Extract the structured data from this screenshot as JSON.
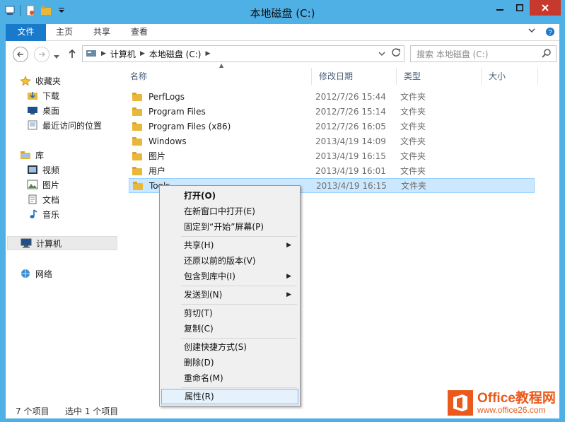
{
  "window": {
    "title": "本地磁盘 (C:)"
  },
  "ribbon": {
    "tabs": [
      "文件",
      "主页",
      "共享",
      "查看"
    ]
  },
  "address": {
    "crumbs": [
      "计算机",
      "本地磁盘 (C:)"
    ],
    "search_placeholder": "搜索 本地磁盘 (C:)"
  },
  "nav": {
    "favorites": "收藏夹",
    "downloads": "下载",
    "desktop": "桌面",
    "recent": "最近访问的位置",
    "libraries": "库",
    "videos": "视频",
    "pictures": "图片",
    "documents": "文档",
    "music": "音乐",
    "computer": "计算机",
    "network": "网络"
  },
  "columns": {
    "name": "名称",
    "date": "修改日期",
    "type": "类型",
    "size": "大小"
  },
  "files": [
    {
      "name": "PerfLogs",
      "date": "2012/7/26 15:44",
      "type": "文件夹"
    },
    {
      "name": "Program Files",
      "date": "2012/7/26 15:14",
      "type": "文件夹"
    },
    {
      "name": "Program Files (x86)",
      "date": "2012/7/26 16:05",
      "type": "文件夹"
    },
    {
      "name": "Windows",
      "date": "2013/4/19 14:09",
      "type": "文件夹"
    },
    {
      "name": "图片",
      "date": "2013/4/19 16:15",
      "type": "文件夹"
    },
    {
      "name": "用户",
      "date": "2013/4/19 16:01",
      "type": "文件夹"
    },
    {
      "name": "Tools",
      "date": "2013/4/19 16:15",
      "type": "文件夹"
    }
  ],
  "context_menu": {
    "open": "打开(O)",
    "open_new_window": "在新窗口中打开(E)",
    "pin_start": "固定到“开始”屏幕(P)",
    "share": "共享(H)",
    "restore": "还原以前的版本(V)",
    "include_library": "包含到库中(I)",
    "send_to": "发送到(N)",
    "cut": "剪切(T)",
    "copy": "复制(C)",
    "create_shortcut": "创建快捷方式(S)",
    "delete": "删除(D)",
    "rename": "重命名(M)",
    "properties": "属性(R)"
  },
  "status": {
    "items": "7 个项目",
    "selected": "选中 1 个项目"
  },
  "watermark": {
    "title": "Office教程网",
    "url": "www.office26.com"
  },
  "colors": {
    "titlebar": "#4eb0e5",
    "file_tab": "#1979ca",
    "close": "#c7382d",
    "selection": "#cce8ff",
    "watermark": "#ea5a1c"
  }
}
